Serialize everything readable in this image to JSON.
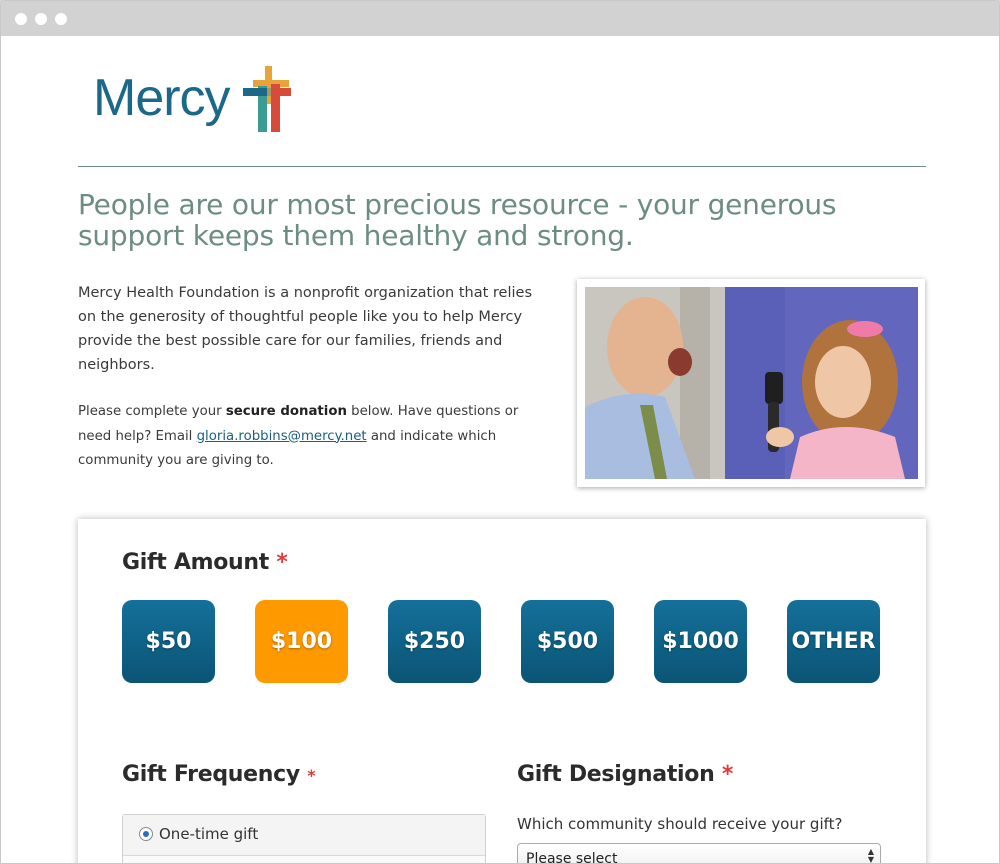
{
  "logo": {
    "text": "Mercy"
  },
  "headline": "People are our most precious resource - your generous support keeps them healthy and strong.",
  "intro": {
    "paragraph1": "Mercy Health Foundation is a nonprofit organization that relies on the generosity of thoughtful people like you to help Mercy provide the best possible care for our families, friends and neighbors.",
    "p2_before": "Please complete your ",
    "p2_bold": "secure donation",
    "p2_mid": " below. Have questions or need help? Email ",
    "email": "gloria.robbins@mercy.net",
    "p2_after": " and indicate which community you are giving to."
  },
  "gift_amount": {
    "title": "Gift Amount",
    "required_mark": "*",
    "options": [
      "$50",
      "$100",
      "$250",
      "$500",
      "$1000",
      "OTHER"
    ],
    "selected": "$100"
  },
  "gift_frequency": {
    "title": "Gift Frequency",
    "required_mark": "*",
    "option1": "One-time gift"
  },
  "gift_designation": {
    "title": "Gift Designation",
    "required_mark": "*",
    "question": "Which community should receive your gift?",
    "select_value": "Please select"
  },
  "colors": {
    "accent": "#0b5475",
    "selected": "#ff9900",
    "heading": "#6d8d84",
    "required": "#e03a3a"
  }
}
